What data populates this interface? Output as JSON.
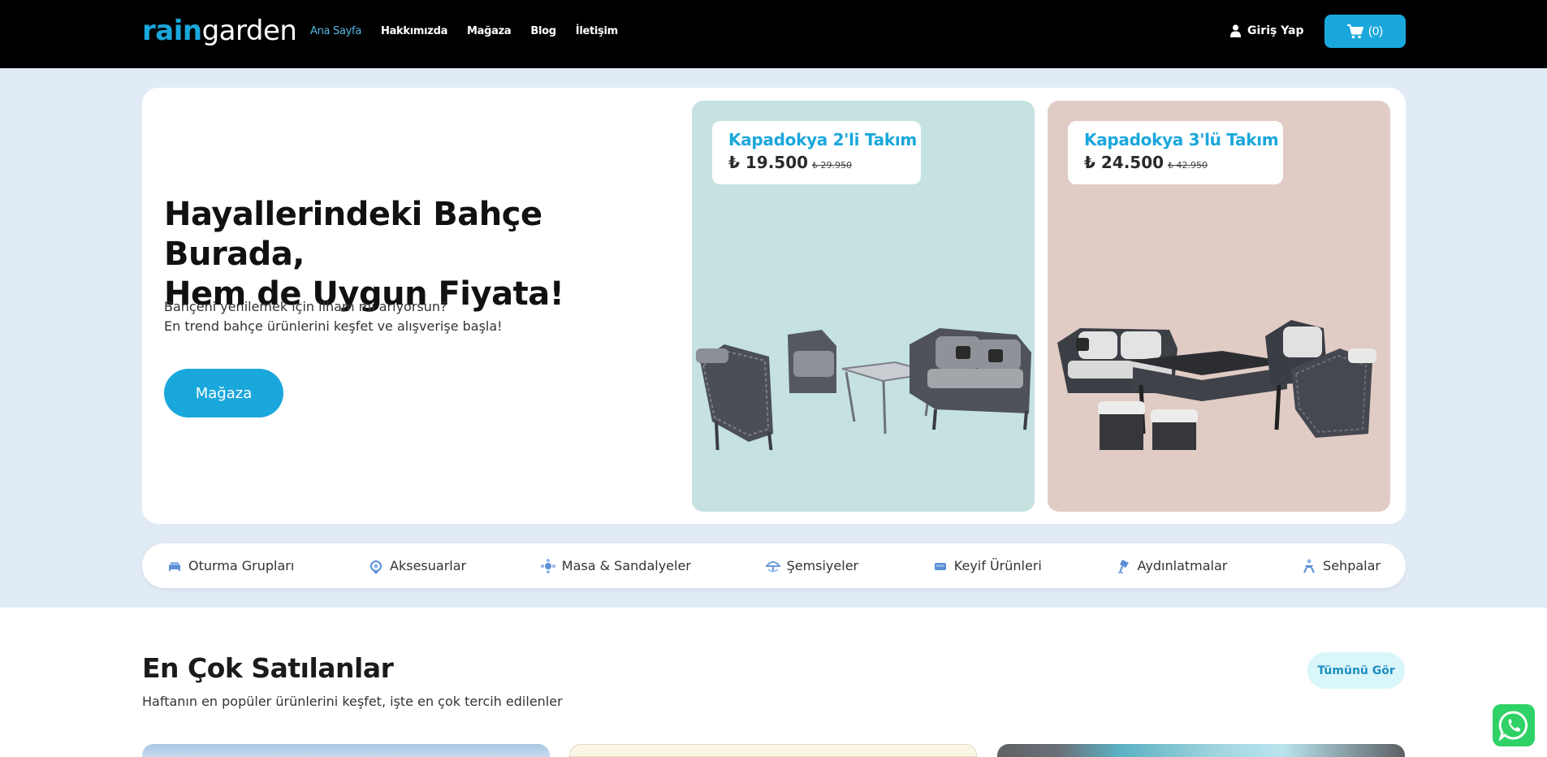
{
  "header": {
    "logo_rain": "rain",
    "logo_garden": "garden",
    "nav": [
      {
        "label": "Ana Sayfa"
      },
      {
        "label": "Hakkımızda"
      },
      {
        "label": "Mağaza"
      },
      {
        "label": "Blog"
      },
      {
        "label": "İletişim"
      }
    ],
    "login_label": "Giriş Yap",
    "cart_count": "(0)"
  },
  "hero": {
    "title_line1": "Hayallerindeki Bahçe Burada,",
    "title_line2": "Hem de Uygun Fiyata!",
    "sub_line1": "Bahçeni yenilemek için ilham mı arıyorsun?",
    "sub_line2": "En trend bahçe ürünlerini keşfet ve alışverişe başla!",
    "button_label": "Mağaza"
  },
  "promos": [
    {
      "name": "Kapadokya 2'li Takım",
      "price": "₺ 19.500",
      "old_price": "₺ 29.950",
      "bg": "#c5e2e0"
    },
    {
      "name": "Kapadokya 3'lü Takım",
      "price": "₺ 24.500",
      "old_price": "₺ 42.950",
      "bg": "#e1cbc5"
    }
  ],
  "categories": [
    {
      "label": "Oturma Grupları",
      "icon": "sofa-icon"
    },
    {
      "label": "Aksesuarlar",
      "icon": "accessory-icon"
    },
    {
      "label": "Masa & Sandalyeler",
      "icon": "table-chairs-icon"
    },
    {
      "label": "Şemsiyeler",
      "icon": "umbrella-icon"
    },
    {
      "label": "Keyif Ürünleri",
      "icon": "leisure-icon"
    },
    {
      "label": "Aydınlatmalar",
      "icon": "lamp-icon"
    },
    {
      "label": "Sehpalar",
      "icon": "side-table-icon"
    }
  ],
  "best_sellers": {
    "title": "En Çok Satılanlar",
    "subtitle": "Haftanın en popüler ürünlerini keşfet, işte en çok tercih edilenler",
    "see_all_label": "Tümünü Gör"
  },
  "colors": {
    "accent": "#1aa7dc",
    "header_bg": "#000000",
    "band_bg": "#e1ebf6",
    "whatsapp": "#2fd266"
  }
}
